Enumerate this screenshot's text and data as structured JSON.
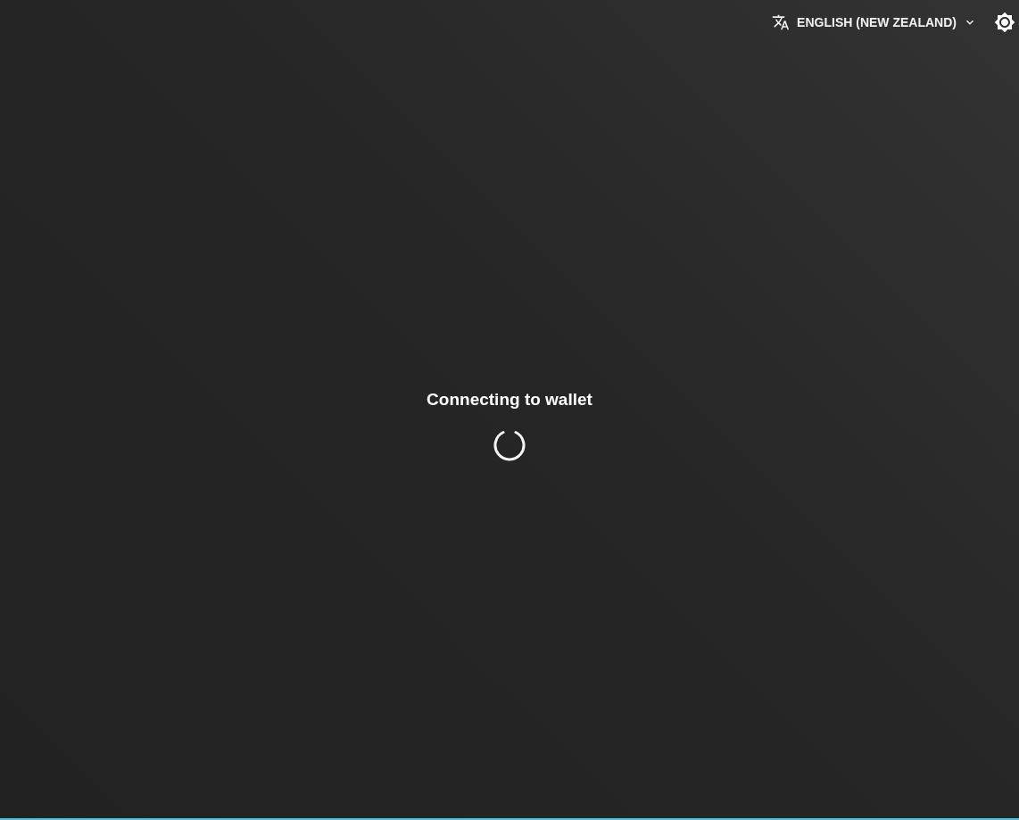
{
  "language_selector": {
    "label": "ENGLISH (NEW ZEALAND)"
  },
  "status": {
    "message": "Connecting to wallet"
  }
}
